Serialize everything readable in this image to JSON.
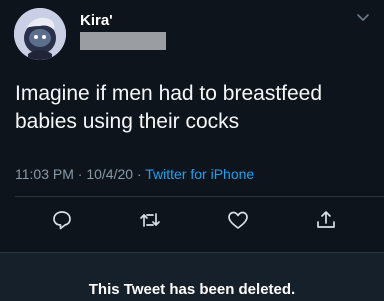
{
  "tweet": {
    "author": {
      "display_name": "Kira'",
      "avatar": "avatar-icon"
    },
    "text": "Imagine if men had to breastfeed babies using their cocks",
    "time": "11:03 PM",
    "date": "10/4/20",
    "separator": "·",
    "source": "Twitter for iPhone",
    "source_color": "#1da1f2"
  },
  "actions": {
    "reply": "reply-icon",
    "retweet": "retweet-icon",
    "like": "heart-icon",
    "share": "share-icon"
  },
  "banner": {
    "message": "This Tweet has been deleted."
  }
}
